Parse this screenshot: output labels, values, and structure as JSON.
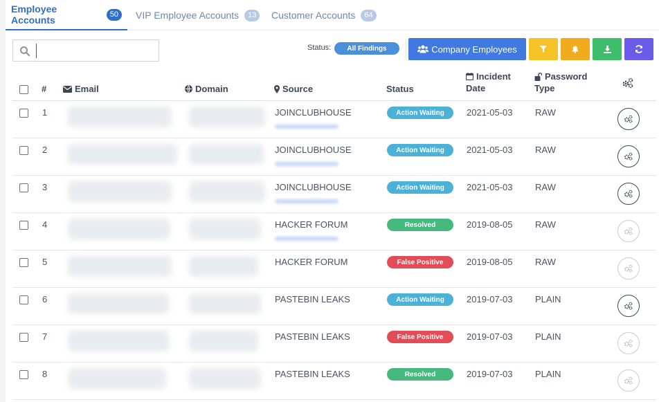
{
  "tabs": [
    {
      "label": "Employee Accounts",
      "count": "50",
      "active": true
    },
    {
      "label": "VIP Employee Accounts",
      "count": "13",
      "active": false
    },
    {
      "label": "Customer Accounts",
      "count": "64",
      "active": false
    }
  ],
  "toolbar": {
    "search_placeholder": "",
    "status_label": "Status:",
    "status_filter": "All Findings",
    "company_button": "Company Employees",
    "icons": [
      "users-icon",
      "filter-icon",
      "bell-icon",
      "download-icon",
      "refresh-icon"
    ]
  },
  "colors": {
    "accent": "#2f6fc6",
    "company": "#4179e0",
    "filter": "#f5c228",
    "bell": "#f0ac1e",
    "download": "#3ebd6b",
    "refresh": "#6a5ce6",
    "waiting": "#4bb1d6",
    "resolved": "#45b87d",
    "false_positive": "#e24c57"
  },
  "table": {
    "headers": {
      "num": "#",
      "email": "Email",
      "domain": "Domain",
      "source": "Source",
      "status": "Status",
      "incident_1": "Incident",
      "incident_2": "Date",
      "password_1": "Password",
      "password_2": "Type"
    },
    "rows": [
      {
        "num": "1",
        "source": "JOINCLUBHOUSE",
        "status": "Action Waiting",
        "status_type": "waiting",
        "date": "2021-05-03",
        "password_type": "RAW"
      },
      {
        "num": "2",
        "source": "JOINCLUBHOUSE",
        "status": "Action Waiting",
        "status_type": "waiting",
        "date": "2021-05-03",
        "password_type": "RAW"
      },
      {
        "num": "3",
        "source": "JOINCLUBHOUSE",
        "status": "Action Waiting",
        "status_type": "waiting",
        "date": "2021-05-03",
        "password_type": "RAW"
      },
      {
        "num": "4",
        "source": "HACKER FORUM",
        "status": "Resolved",
        "status_type": "resolved",
        "date": "2019-08-05",
        "password_type": "RAW"
      },
      {
        "num": "5",
        "source": "HACKER FORUM",
        "status": "False Positive",
        "status_type": "false",
        "date": "2019-08-05",
        "password_type": "RAW"
      },
      {
        "num": "6",
        "source": "PASTEBIN LEAKS",
        "status": "Action Waiting",
        "status_type": "waiting",
        "date": "2019-07-03",
        "password_type": "PLAIN"
      },
      {
        "num": "7",
        "source": "PASTEBIN LEAKS",
        "status": "False Positive",
        "status_type": "false",
        "date": "2019-07-03",
        "password_type": "PLAIN"
      },
      {
        "num": "8",
        "source": "PASTEBIN LEAKS",
        "status": "Resolved",
        "status_type": "resolved",
        "date": "2019-07-03",
        "password_type": "PLAIN"
      }
    ]
  }
}
